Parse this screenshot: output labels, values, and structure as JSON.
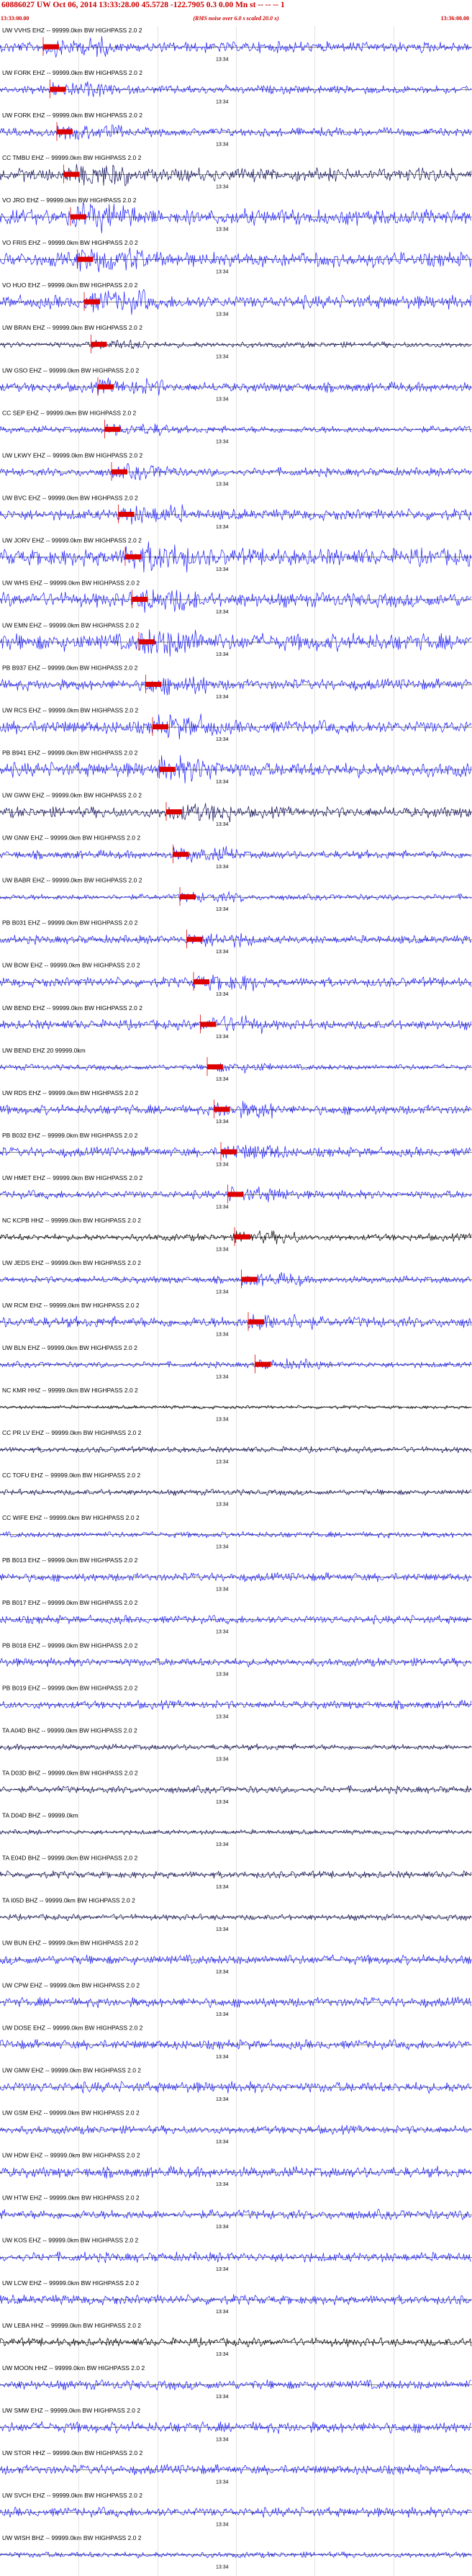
{
  "header": {
    "title": "60886027 UW Oct 06, 2014 13:33:28.00  45.5728 -122.7905  0.3 0.00 Mn st  -- -- --  1",
    "start_time": "13:33:00.00",
    "subtitle": "(RMS noise over 6.0 s scaled 20.0 x)",
    "end_time": "13:36:00.00"
  },
  "colors": {
    "trace_primary": "#1a1aff",
    "trace_dark": "#0b0b5a",
    "trace_black": "#000000",
    "pick": "#dd0000",
    "text_red": "#cc0000"
  },
  "chart_data": {
    "type": "line",
    "title": "60886027 UW Oct 06, 2014 13:33:28.00  45.5728 -122.7905  0.3 0.00 Mn st  -- -- --  1",
    "xlabel": "",
    "ylabel": "",
    "x_range": [
      "13:33:00.00",
      "13:36:00.00"
    ],
    "grid": true,
    "minute_mark": "13:34",
    "series": [
      {
        "name": "UW VVHS EHZ -- 99999.0km BW  HIGHPASS  2.0  2",
        "color": "primary",
        "amp": 9
      },
      {
        "name": "UW FORK EHZ -- 99999.0km BW  HIGHPASS  2.0  2",
        "color": "primary",
        "amp": 7
      },
      {
        "name": "UW FORK EHZ -- 99999.0km BW  HIGHPASS  2.0  2",
        "color": "primary",
        "amp": 7
      },
      {
        "name": "CC TMBU EHZ -- 99999.0km BW  HIGHPASS  2.0  2",
        "color": "dark",
        "amp": 11
      },
      {
        "name": "VO JRO EHZ -- 99999.0km BW  HIGHPASS  2.0  2",
        "color": "primary",
        "amp": 13
      },
      {
        "name": "VO FRIS EHZ -- 99999.0km BW  HIGHPASS  2.0  2",
        "color": "primary",
        "amp": 12
      },
      {
        "name": "VO HUO EHZ -- 99999.0km BW  HIGHPASS  2.0  2",
        "color": "primary",
        "amp": 11
      },
      {
        "name": "UW BRAN EHZ -- 99999.0km BW  HIGHPASS  2.0  2",
        "color": "dark",
        "amp": 5
      },
      {
        "name": "UW GSO EHZ -- 99999.0km BW  HIGHPASS  2.0  2",
        "color": "primary",
        "amp": 8
      },
      {
        "name": "CC SEP EHZ -- 99999.0km BW  HIGHPASS  2.0  2",
        "color": "primary",
        "amp": 6
      },
      {
        "name": "UW LKWY EHZ -- 99999.0km BW  HIGHPASS  2.0  2",
        "color": "primary",
        "amp": 7
      },
      {
        "name": "UW BVC EHZ -- 99999.0km BW  HIGHPASS  2.0  2",
        "color": "primary",
        "amp": 9
      },
      {
        "name": "UW JORV EHZ -- 99999.0km BW  HIGHPASS  2.0  2",
        "color": "primary",
        "amp": 14
      },
      {
        "name": "UW WHS EHZ -- 99999.0km BW  HIGHPASS  2.0  2",
        "color": "primary",
        "amp": 12
      },
      {
        "name": "UW EMN EHZ -- 99999.0km BW  HIGHPASS  2.0  2",
        "color": "primary",
        "amp": 14
      },
      {
        "name": "PB B937 EHZ -- 99999.0km BW  HIGHPASS  2.0  2",
        "color": "primary",
        "amp": 9
      },
      {
        "name": "UW RCS EHZ -- 99999.0km BW  HIGHPASS  2.0  2",
        "color": "primary",
        "amp": 11
      },
      {
        "name": "PB B941 EHZ -- 99999.0km BW  HIGHPASS  2.0  2",
        "color": "primary",
        "amp": 12
      },
      {
        "name": "UW GWW EHZ -- 99999.0km BW  HIGHPASS  2.0  2",
        "color": "dark",
        "amp": 9
      },
      {
        "name": "UW GNW EHZ -- 99999.0km BW  HIGHPASS  2.0  2",
        "color": "primary",
        "amp": 7
      },
      {
        "name": "UW BABR EHZ -- 99999.0km BW  HIGHPASS  2.0  2",
        "color": "primary",
        "amp": 5
      },
      {
        "name": "PB B031 EHZ -- 99999.0km BW  HIGHPASS  2.0  2",
        "color": "primary",
        "amp": 7
      },
      {
        "name": "UW BOW EHZ -- 99999.0km BW  HIGHPASS  2.0  2",
        "color": "primary",
        "amp": 8
      },
      {
        "name": "UW BEND EHZ -- 99999.0km BW  HIGHPASS  2.0  2",
        "color": "primary",
        "amp": 8
      },
      {
        "name": "UW BEND EHZ 20 99999.0km",
        "color": "primary",
        "amp": 5
      },
      {
        "name": "UW RDS EHZ -- 99999.0km BW  HIGHPASS  2.0  2",
        "color": "primary",
        "amp": 8
      },
      {
        "name": "PB B032 EHZ -- 99999.0km BW  HIGHPASS  2.0  2",
        "color": "primary",
        "amp": 8
      },
      {
        "name": "UW HMET EHZ -- 99999.0km BW  HIGHPASS  2.0  2",
        "color": "primary",
        "amp": 7
      },
      {
        "name": "NC KCPB HHZ -- 99999.0km BW  HIGHPASS  2.0  2",
        "color": "black",
        "amp": 6
      },
      {
        "name": "UW JEDS EHZ -- 99999.0km BW  HIGHPASS  2.0  2",
        "color": "primary",
        "amp": 6
      },
      {
        "name": "UW RCM EHZ -- 99999.0km BW  HIGHPASS  2.0  2",
        "color": "primary",
        "amp": 9
      },
      {
        "name": "UW BLN EHZ -- 99999.0km BW  HIGHPASS  2.0  2",
        "color": "primary",
        "amp": 5
      },
      {
        "name": "NC KMR HHZ -- 99999.0km BW  HIGHPASS  2.0  2",
        "color": "black",
        "amp": 3
      },
      {
        "name": "CC PR LV EHZ -- 99999.0km BW  HIGHPASS  2.0  2",
        "color": "dark",
        "amp": 5
      },
      {
        "name": "CC TOFU EHZ -- 99999.0km BW  HIGHPASS  2.0  2",
        "color": "dark",
        "amp": 5
      },
      {
        "name": "CC WIFE EHZ -- 99999.0km BW  HIGHPASS  2.0  2",
        "color": "primary",
        "amp": 5
      },
      {
        "name": "PB B013 EHZ -- 99999.0km BW  HIGHPASS  2.0  2",
        "color": "primary",
        "amp": 7
      },
      {
        "name": "PB B017 EHZ -- 99999.0km BW  HIGHPASS  2.0  2",
        "color": "primary",
        "amp": 7
      },
      {
        "name": "PB B018 EHZ -- 99999.0km BW  HIGHPASS  2.0  2",
        "color": "primary",
        "amp": 7
      },
      {
        "name": "PB B019 EHZ -- 99999.0km BW  HIGHPASS  2.0  2",
        "color": "primary",
        "amp": 7
      },
      {
        "name": "TA A04D BHZ -- 99999.0km BW  HIGHPASS  2.0  2",
        "color": "dark",
        "amp": 5
      },
      {
        "name": "TA D03D BHZ -- 99999.0km BW  HIGHPASS  2.0  2",
        "color": "dark",
        "amp": 6
      },
      {
        "name": "TA D04D BHZ -- 99999.0km",
        "color": "dark",
        "amp": 4
      },
      {
        "name": "TA E04D BHZ -- 99999.0km BW  HIGHPASS  2.0  2",
        "color": "dark",
        "amp": 6
      },
      {
        "name": "TA I05D BHZ -- 99999.0km BW  HIGHPASS  2.0  2",
        "color": "dark",
        "amp": 5
      },
      {
        "name": "UW BUN EHZ -- 99999.0km BW  HIGHPASS  2.0  2",
        "color": "primary",
        "amp": 8
      },
      {
        "name": "UW CPW EHZ -- 99999.0km BW  HIGHPASS  2.0  2",
        "color": "primary",
        "amp": 8
      },
      {
        "name": "UW DOSE EHZ -- 99999.0km BW  HIGHPASS  2.0  2",
        "color": "primary",
        "amp": 8
      },
      {
        "name": "UW GMW EHZ -- 99999.0km BW  HIGHPASS  2.0  2",
        "color": "primary",
        "amp": 9
      },
      {
        "name": "UW GSM EHZ -- 99999.0km BW  HIGHPASS  2.0  2",
        "color": "primary",
        "amp": 7
      },
      {
        "name": "UW HDW EHZ -- 99999.0km BW  HIGHPASS  2.0  2",
        "color": "primary",
        "amp": 9
      },
      {
        "name": "UW HTW EHZ -- 99999.0km BW  HIGHPASS  2.0  2",
        "color": "primary",
        "amp": 8
      },
      {
        "name": "UW KOS EHZ -- 99999.0km BW  HIGHPASS  2.0  2",
        "color": "primary",
        "amp": 8
      },
      {
        "name": "UW LCW EHZ -- 99999.0km BW  HIGHPASS  2.0  2",
        "color": "primary",
        "amp": 8
      },
      {
        "name": "UW LEBA HHZ -- 99999.0km BW  HIGHPASS  2.0  2",
        "color": "black",
        "amp": 7
      },
      {
        "name": "UW MOON HHZ -- 99999.0km BW  HIGHPASS  2.0  2",
        "color": "primary",
        "amp": 8
      },
      {
        "name": "UW SMW EHZ -- 99999.0km BW  HIGHPASS  2.0  2",
        "color": "primary",
        "amp": 9
      },
      {
        "name": "UW STOR HHZ -- 99999.0km BW  HIGHPASS  2.0  2",
        "color": "primary",
        "amp": 8
      },
      {
        "name": "UW SVCH EHZ -- 99999.0km BW  HIGHPASS  2.0  2",
        "color": "primary",
        "amp": 8
      },
      {
        "name": "UW WISH BHZ -- 99999.0km BW  HIGHPASS  2.0  2",
        "color": "primary",
        "amp": 5
      }
    ]
  }
}
